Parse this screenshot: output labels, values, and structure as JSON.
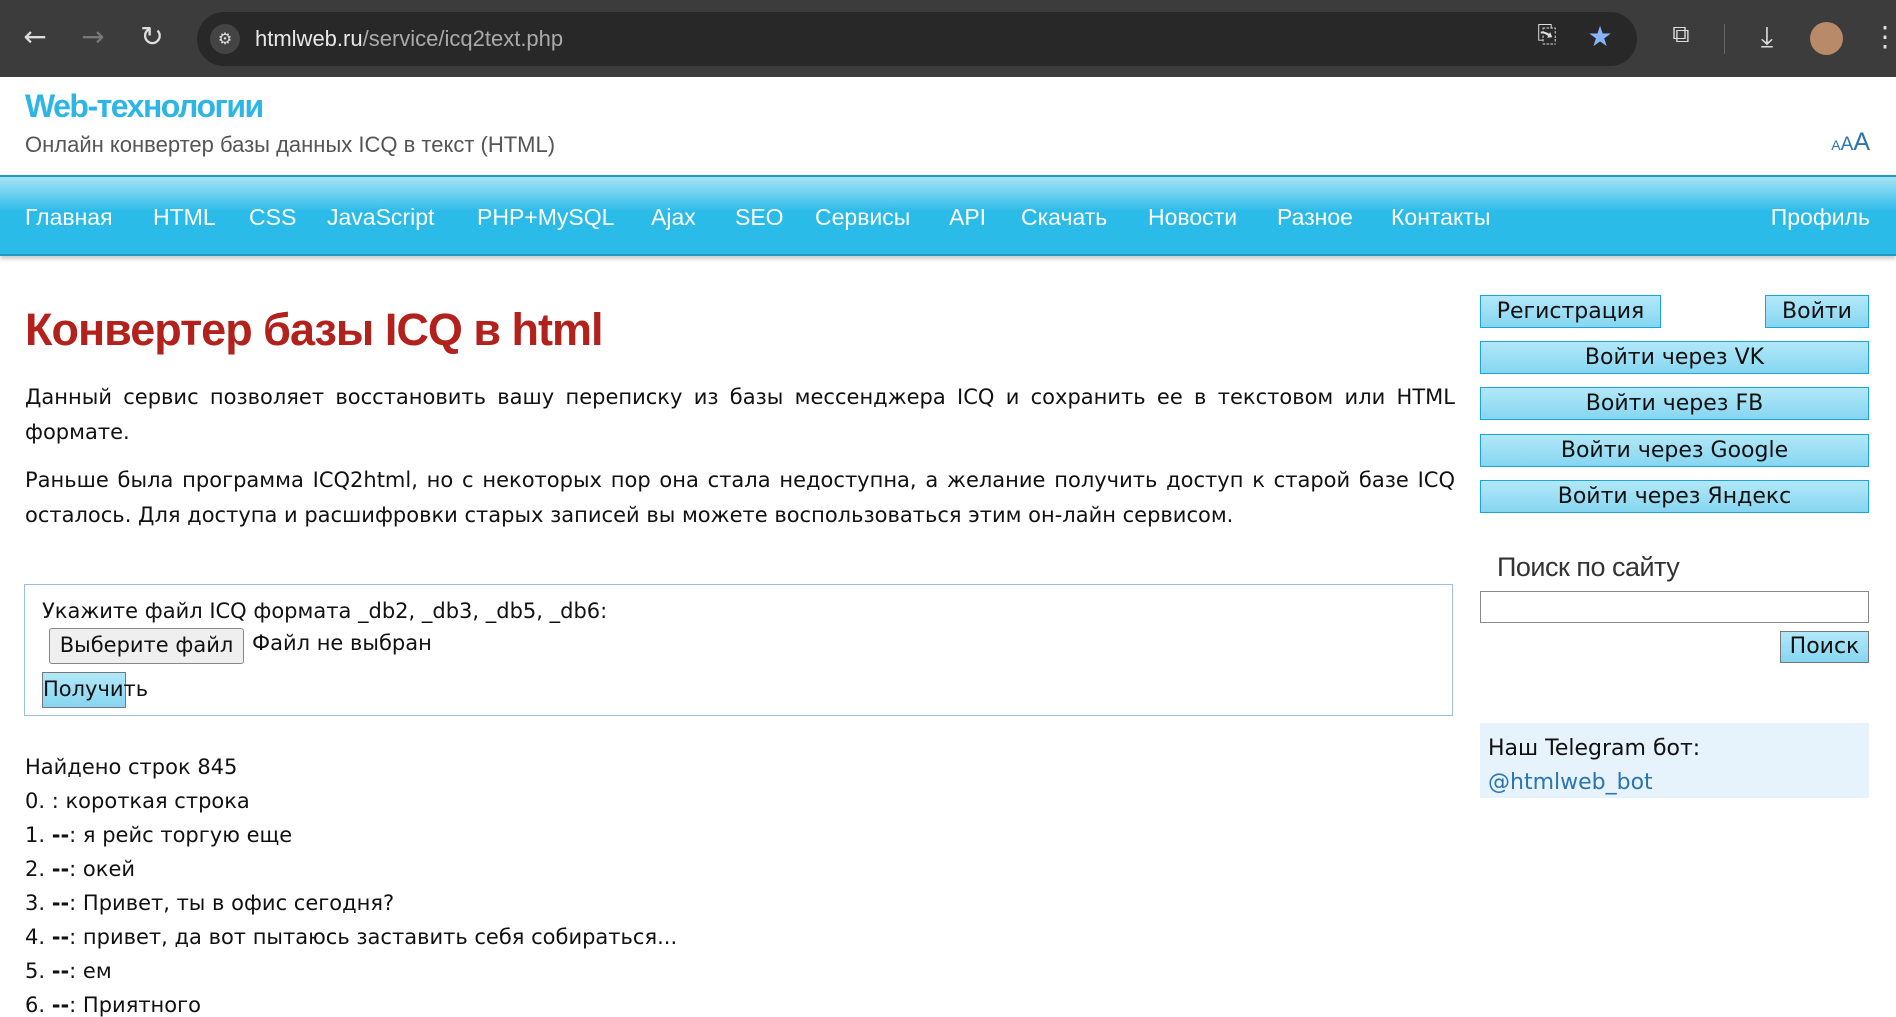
{
  "browser": {
    "url_host": "htmlweb.ru",
    "url_path": "/service/icq2text.php"
  },
  "header": {
    "title": "Web-технологии",
    "subtitle": "Онлайн конвертер базы данных ICQ в текст (HTML)",
    "font_small": "A",
    "font_mid": "A",
    "font_large": "A"
  },
  "nav": {
    "items": [
      "Главная",
      "HTML",
      "CSS",
      "JavaScript",
      "PHP+MySQL",
      "Ajax",
      "SEO",
      "Сервисы",
      "API",
      "Скачать",
      "Новости",
      "Разное",
      "Контакты"
    ],
    "profile": "Профиль"
  },
  "main": {
    "title": "Конвертер базы ICQ в html",
    "para1": "Данный сервис позволяет восстановить вашу переписку из базы мессенджера ICQ и сохранить ее в текстовом или HTML формате.",
    "para2": "Раньше была программа ICQ2html, но с некоторых пор она стала недоступна, а желание получить доступ к старой базе ICQ осталось. Для доступа и расшифровки старых записей вы можете воспользоваться этим он-лайн сервисом.",
    "form": {
      "label": "Укажите файл ICQ формата _db2, _db3, _db5, _db6:",
      "choose_file": "Выберите файл",
      "no_file": "Файл не выбран",
      "submit": "Получить"
    },
    "found": "Найдено строк 845",
    "rows": [
      {
        "n": "0.",
        "author": "",
        "text": ": короткая строка"
      },
      {
        "n": "1.",
        "author": "--",
        "text": ": я рейс торгую еще"
      },
      {
        "n": "2.",
        "author": "--",
        "text": ": окей"
      },
      {
        "n": "3.",
        "author": "--",
        "text": ": Привет, ты в офис сегодня?"
      },
      {
        "n": "4.",
        "author": "--",
        "text": ": привет, да вот пытаюсь заставить себя собираться..."
      },
      {
        "n": "5.",
        "author": "--",
        "text": ": ем"
      },
      {
        "n": "6.",
        "author": "--",
        "text": ": Приятного"
      }
    ]
  },
  "sidebar": {
    "register": "Регистрация",
    "login": "Войти",
    "vk": "Войти через VK",
    "fb": "Войти через FB",
    "google": "Войти через Google",
    "yandex": "Войти через Яндекс",
    "search_title": "Поиск по сайту",
    "search_value": "",
    "search_button": "Поиск",
    "tg_label": "Наш Telegram бот:",
    "tg_link": "@htmlweb_bot"
  }
}
